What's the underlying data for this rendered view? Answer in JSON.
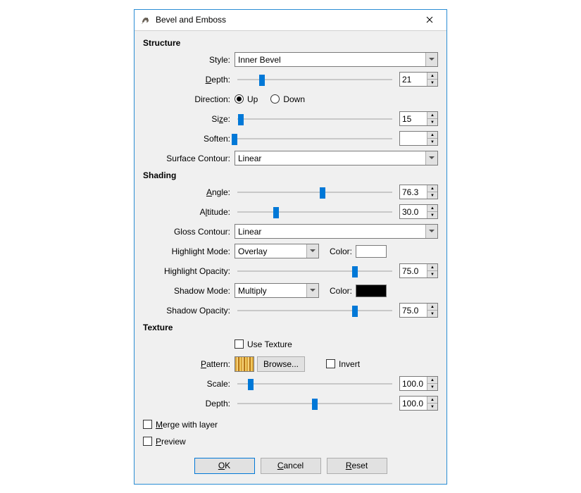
{
  "window": {
    "title": "Bevel and Emboss"
  },
  "sections": {
    "structure": "Structure",
    "shading": "Shading",
    "texture": "Texture"
  },
  "structure": {
    "style_label": "Style:",
    "style_value": "Inner Bevel",
    "depth_label_pre": "",
    "depth_mn": "D",
    "depth_label_post": "epth:",
    "depth_value": "21",
    "depth_percent": 17,
    "direction_label": "Direction:",
    "dir_up": "Up",
    "dir_down": "Down",
    "dir_selected": "up",
    "size_label_pre": "Si",
    "size_mn": "z",
    "size_label_post": "e:",
    "size_value": "15",
    "size_percent": 4,
    "soften_label": "Soften:",
    "soften_value": "",
    "soften_percent": 0,
    "surface_contour_label": "Surface Contour:",
    "surface_contour_value": "Linear"
  },
  "shading": {
    "angle_label_pre": "",
    "angle_mn": "A",
    "angle_label_post": "ngle:",
    "angle_value": "76.3",
    "angle_percent": 55,
    "altitude_label_pre": "A",
    "altitude_mn": "l",
    "altitude_label_post": "titude:",
    "altitude_value": "30.0",
    "altitude_percent": 26,
    "gloss_contour_label": "Gloss Contour:",
    "gloss_contour_value": "Linear",
    "highlight_mode_label": "Highlight Mode:",
    "highlight_mode_value": "Overlay",
    "highlight_color_label": "Color:",
    "highlight_color_hex": "#ffffff",
    "highlight_opacity_label": "Highlight Opacity:",
    "highlight_opacity_value": "75.0",
    "highlight_opacity_percent": 75,
    "shadow_mode_label": "Shadow Mode:",
    "shadow_mode_value": "Multiply",
    "shadow_color_label": "Color:",
    "shadow_color_hex": "#000000",
    "shadow_opacity_label": "Shadow Opacity:",
    "shadow_opacity_value": "75.0",
    "shadow_opacity_percent": 75
  },
  "texture": {
    "use_texture_label": "Use Texture",
    "use_texture_checked": false,
    "pattern_label_pre": "",
    "pattern_mn": "P",
    "pattern_label_post": "attern:",
    "browse_label": "Browse...",
    "invert_label": "Invert",
    "invert_checked": false,
    "scale_label": "Scale:",
    "scale_value": "100.0",
    "scale_percent": 10,
    "depth_label": "Depth:",
    "depth_value": "100.0",
    "depth_percent": 50
  },
  "footer": {
    "merge_mn": "M",
    "merge_label_post": "erge with layer",
    "merge_checked": false,
    "preview_mn": "P",
    "preview_label_post": "review",
    "preview_checked": false
  },
  "buttons": {
    "ok_mn": "O",
    "ok_post": "K",
    "cancel_mn": "C",
    "cancel_post": "ancel",
    "reset_mn": "R",
    "reset_post": "eset"
  }
}
